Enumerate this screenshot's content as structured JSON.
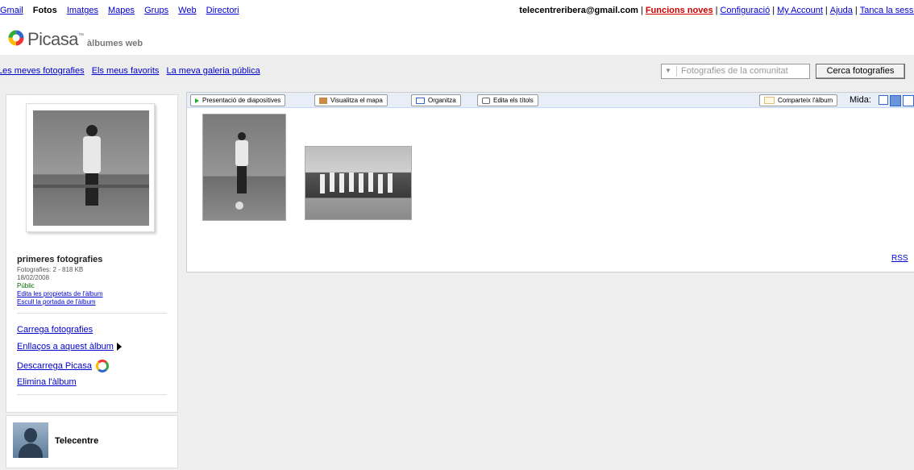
{
  "gbar": {
    "links": [
      "Gmail",
      "Fotos",
      "Imatges",
      "Mapes",
      "Grups",
      "Web",
      "Directori"
    ],
    "current": "Fotos"
  },
  "guser": {
    "email": "telecentreribera@gmail.com",
    "new_features": "Funcions noves",
    "settings": "Configuració",
    "account": "My Account",
    "help": "Ajuda",
    "signout": "Tanca la sessió"
  },
  "logo": {
    "wordmark": "Picasa",
    "tm": "™",
    "subtitle": "àlbumes web"
  },
  "nav": {
    "links": [
      "Les meves fotografies",
      "Els meus favorits",
      "La meva galeria pública"
    ]
  },
  "search": {
    "placeholder": "Fotografies de la comunitat",
    "button": "Cerca fotografies",
    "dropdown_icon": "▼"
  },
  "album": {
    "title": "primeres fotografies",
    "count": "Fotografies: 2 - 818 KB",
    "date": "18/02/2008",
    "visibility": "Públic",
    "edit_props": "Edita les propietats de l'àlbum",
    "choose_cover": "Escull la portada de l'àlbum"
  },
  "actions": {
    "upload": "Carrega fotografies",
    "links": "Enllaços a aquest àlbum",
    "download": "Descarrega Picasa",
    "delete": "Elimina l'àlbum"
  },
  "user": {
    "name": "Telecentre"
  },
  "toolbar": {
    "slideshow": "Presentació de diapositives",
    "map": "Visualitza el mapa",
    "organize": "Organitza",
    "captions": "Edita els títols",
    "share": "Comparteix l'àlbum",
    "size_label": "Mida:"
  },
  "rss": "RSS",
  "colors": {
    "link": "#0000cc",
    "new": "#cc0000",
    "toolbar_bg": "#e8eef7",
    "page_bg": "#efefef"
  }
}
